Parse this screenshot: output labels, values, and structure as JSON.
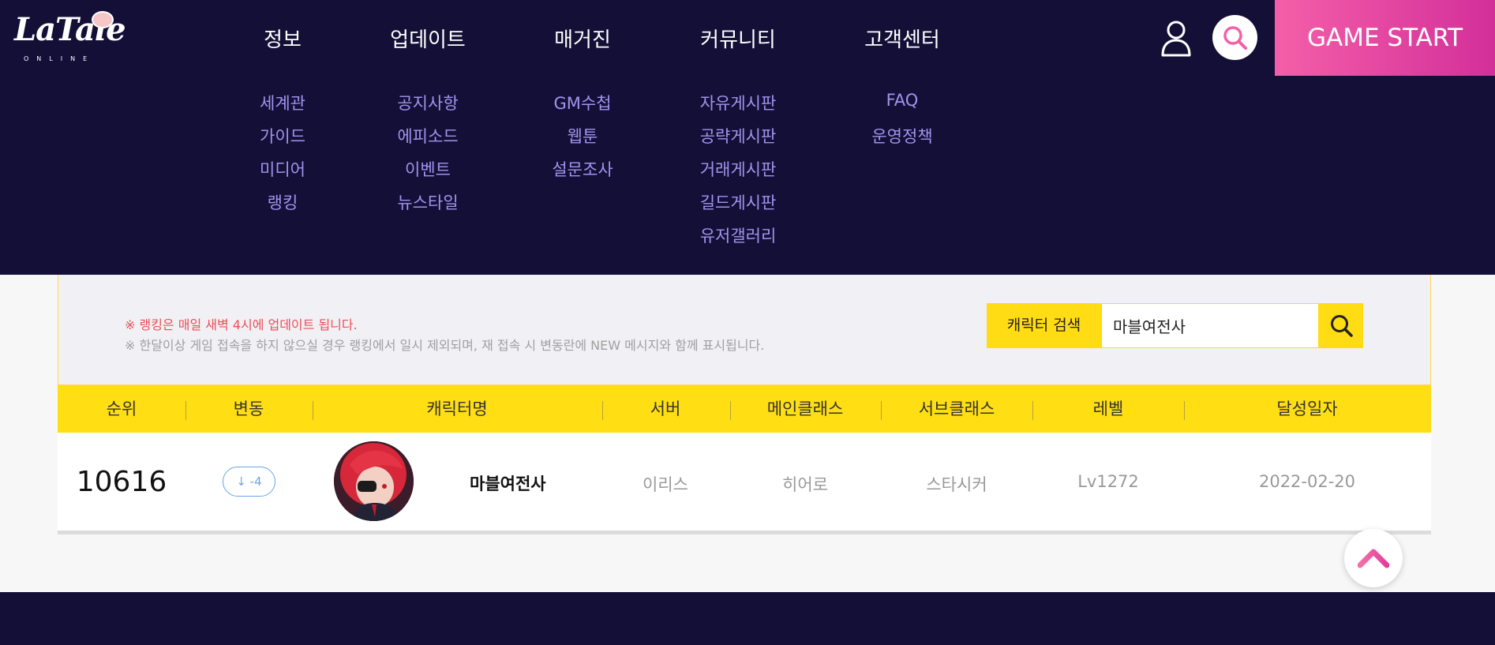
{
  "brand": {
    "logo_text": "LaTale",
    "logo_sub": "ONLINE"
  },
  "nav": {
    "main": [
      "정보",
      "업데이트",
      "매거진",
      "커뮤니티",
      "고객센터"
    ],
    "sub": [
      [
        "세계관",
        "가이드",
        "미디어",
        "랭킹"
      ],
      [
        "공지사항",
        "에피소드",
        "이벤트",
        "뉴스타일"
      ],
      [
        "GM수첩",
        "웹툰",
        "설문조사"
      ],
      [
        "자유게시판",
        "공략게시판",
        "거래게시판",
        "길드게시판",
        "유저갤러리"
      ],
      [
        "FAQ",
        "운영정책"
      ]
    ]
  },
  "header": {
    "game_start": "GAME START",
    "icons": [
      "user-icon",
      "search-icon"
    ]
  },
  "notice": {
    "line1": "※ 랭킹은 매일 새벽 4시에 업데이트 됩니다.",
    "line2": "※ 한달이상 게임 접속을 하지 않으실 경우 랭킹에서 일시 제외되며, 재 접속 시 변동란에 NEW 메시지와 함께 표시됩니다."
  },
  "search": {
    "label": "캐릭터 검색",
    "value": "마블여전사"
  },
  "table": {
    "headers": [
      "순위",
      "변동",
      "캐릭터명",
      "서버",
      "메인클래스",
      "서브클래스",
      "레벨",
      "달성일자"
    ],
    "rows": [
      {
        "rank": "10616",
        "change": "↓ -4",
        "name": "마블여전사",
        "server": "이리스",
        "main_class": "히어로",
        "sub_class": "스타시커",
        "level": "Lv1272",
        "date": "2022-02-20"
      }
    ]
  },
  "colors": {
    "header_bg": "#140f36",
    "accent_yellow": "#ffde14",
    "accent_pink": "#f45fa8",
    "submenu": "#9f95ee"
  }
}
